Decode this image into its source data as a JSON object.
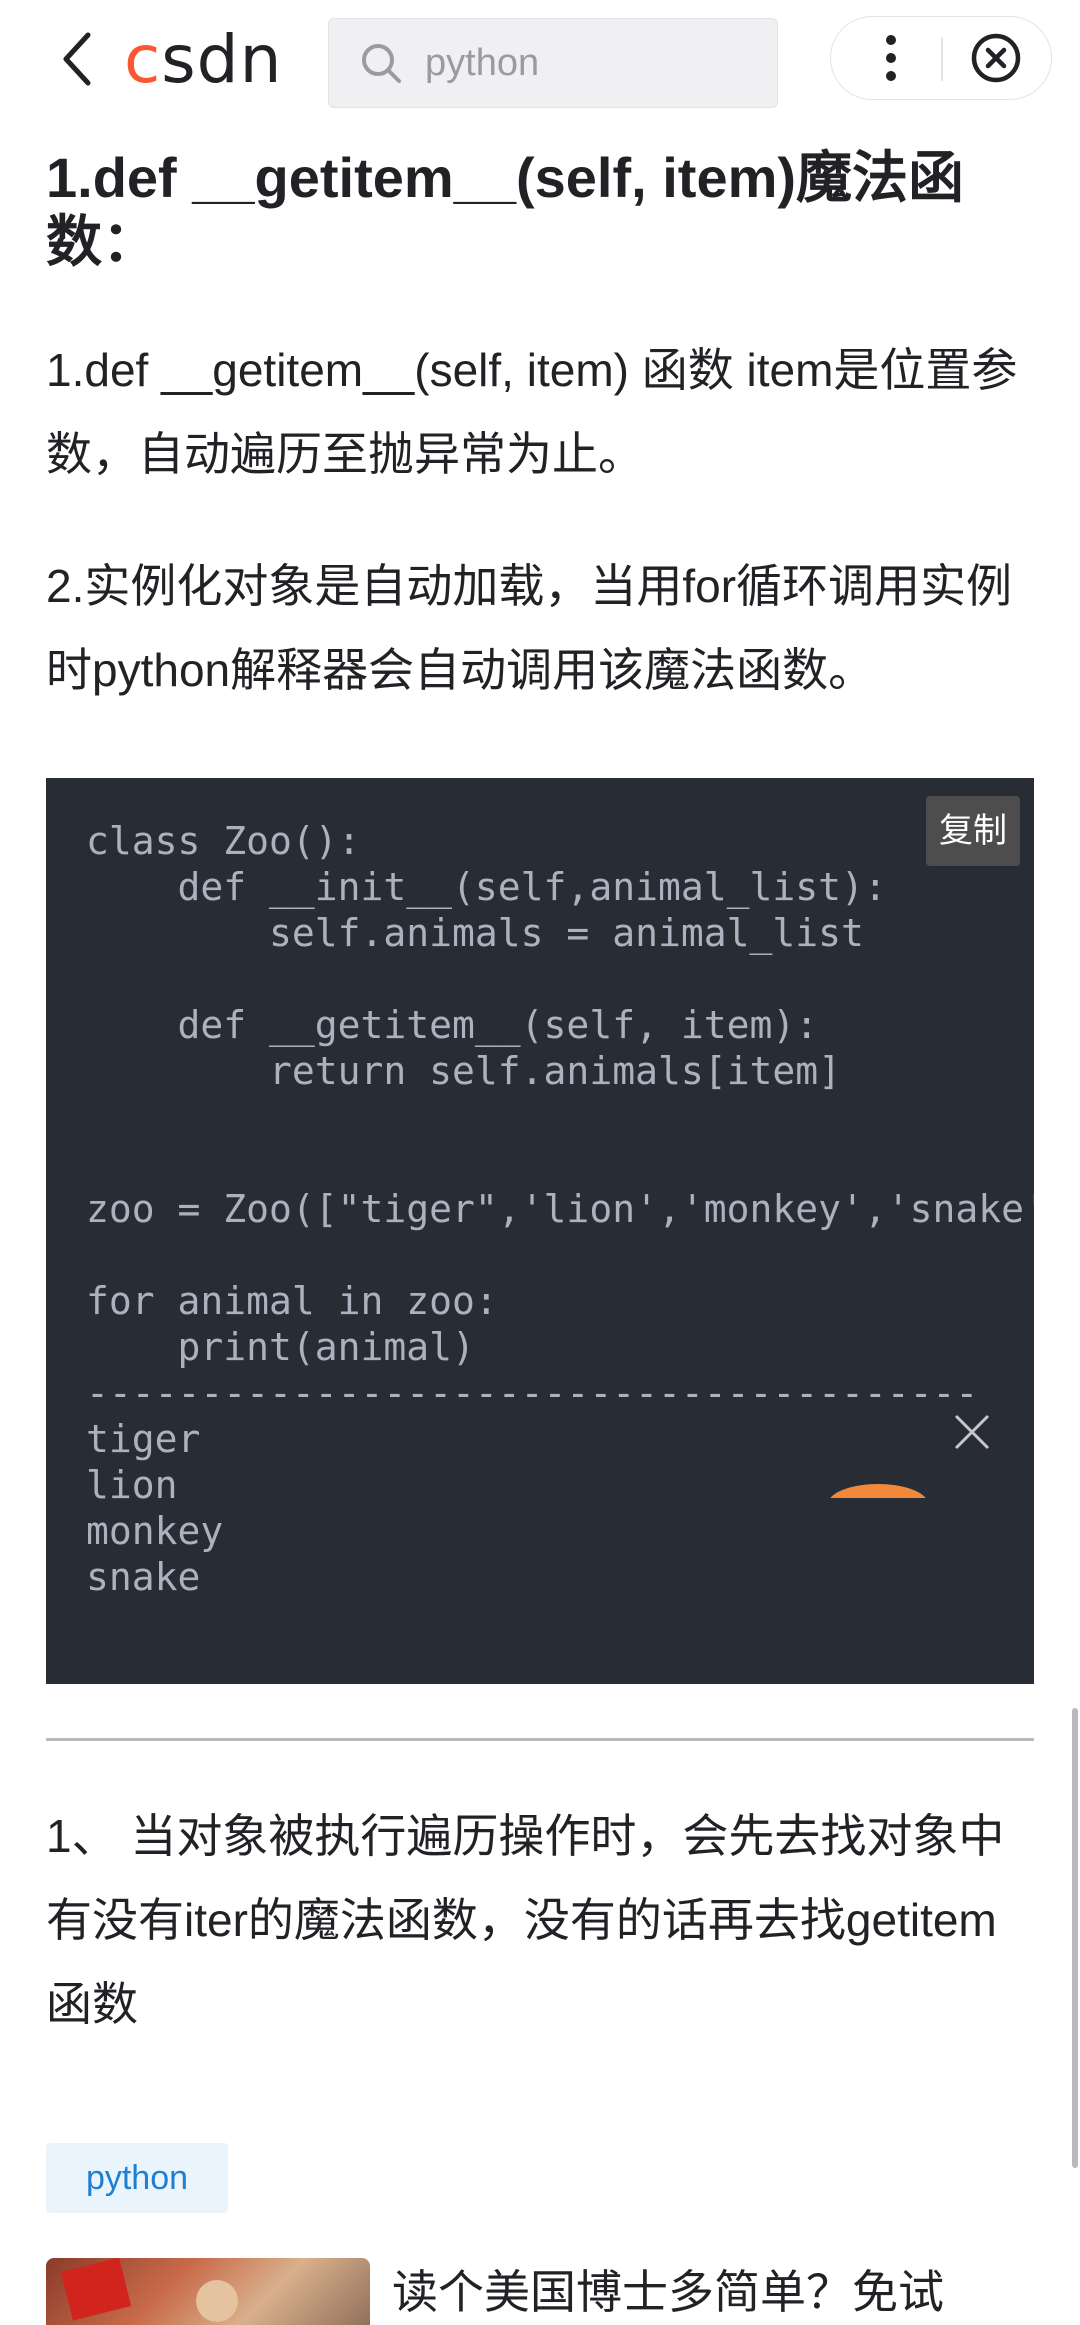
{
  "topbar": {
    "logo_c": "c",
    "logo_rest": "sdn",
    "search_text": "python",
    "icons": {
      "back": "chevron-left-icon",
      "search": "search-icon",
      "more": "more-vertical-icon",
      "close": "close-circle-icon"
    },
    "brand_color": "#fc5531"
  },
  "article": {
    "heading": "1.def __getitem__(self, item)魔法函数：",
    "paragraph_1": "1.def __getitem__(self, item) 函数 item是位置参数，自动遍历至抛异常为止。",
    "paragraph_2": "2.实例化对象是自动加载，当用for循环调用实例时python解释器会自动调用该魔法函数。",
    "code": {
      "copy_label": "复制",
      "content": "class Zoo():\n    def __init__(self,animal_list):\n        self.animals = animal_list\n\n    def __getitem__(self, item):\n        return self.animals[item]\n\n\nzoo = Zoo([\"tiger\",'lion','monkey','snake'])\n\nfor animal in zoo:\n    print(animal)\n---------------------------------------\ntiger\nlion\nmonkey\nsnake",
      "background": "#282c34"
    },
    "paragraph_3": "1、 当对象被执行遍历操作时，会先去找对象中有没有iter的魔法函数，没有的话再去找getitem函数"
  },
  "tags": [
    {
      "label": "python"
    }
  ],
  "recommendation": {
    "title": "读个美国博士多简单？免试"
  }
}
